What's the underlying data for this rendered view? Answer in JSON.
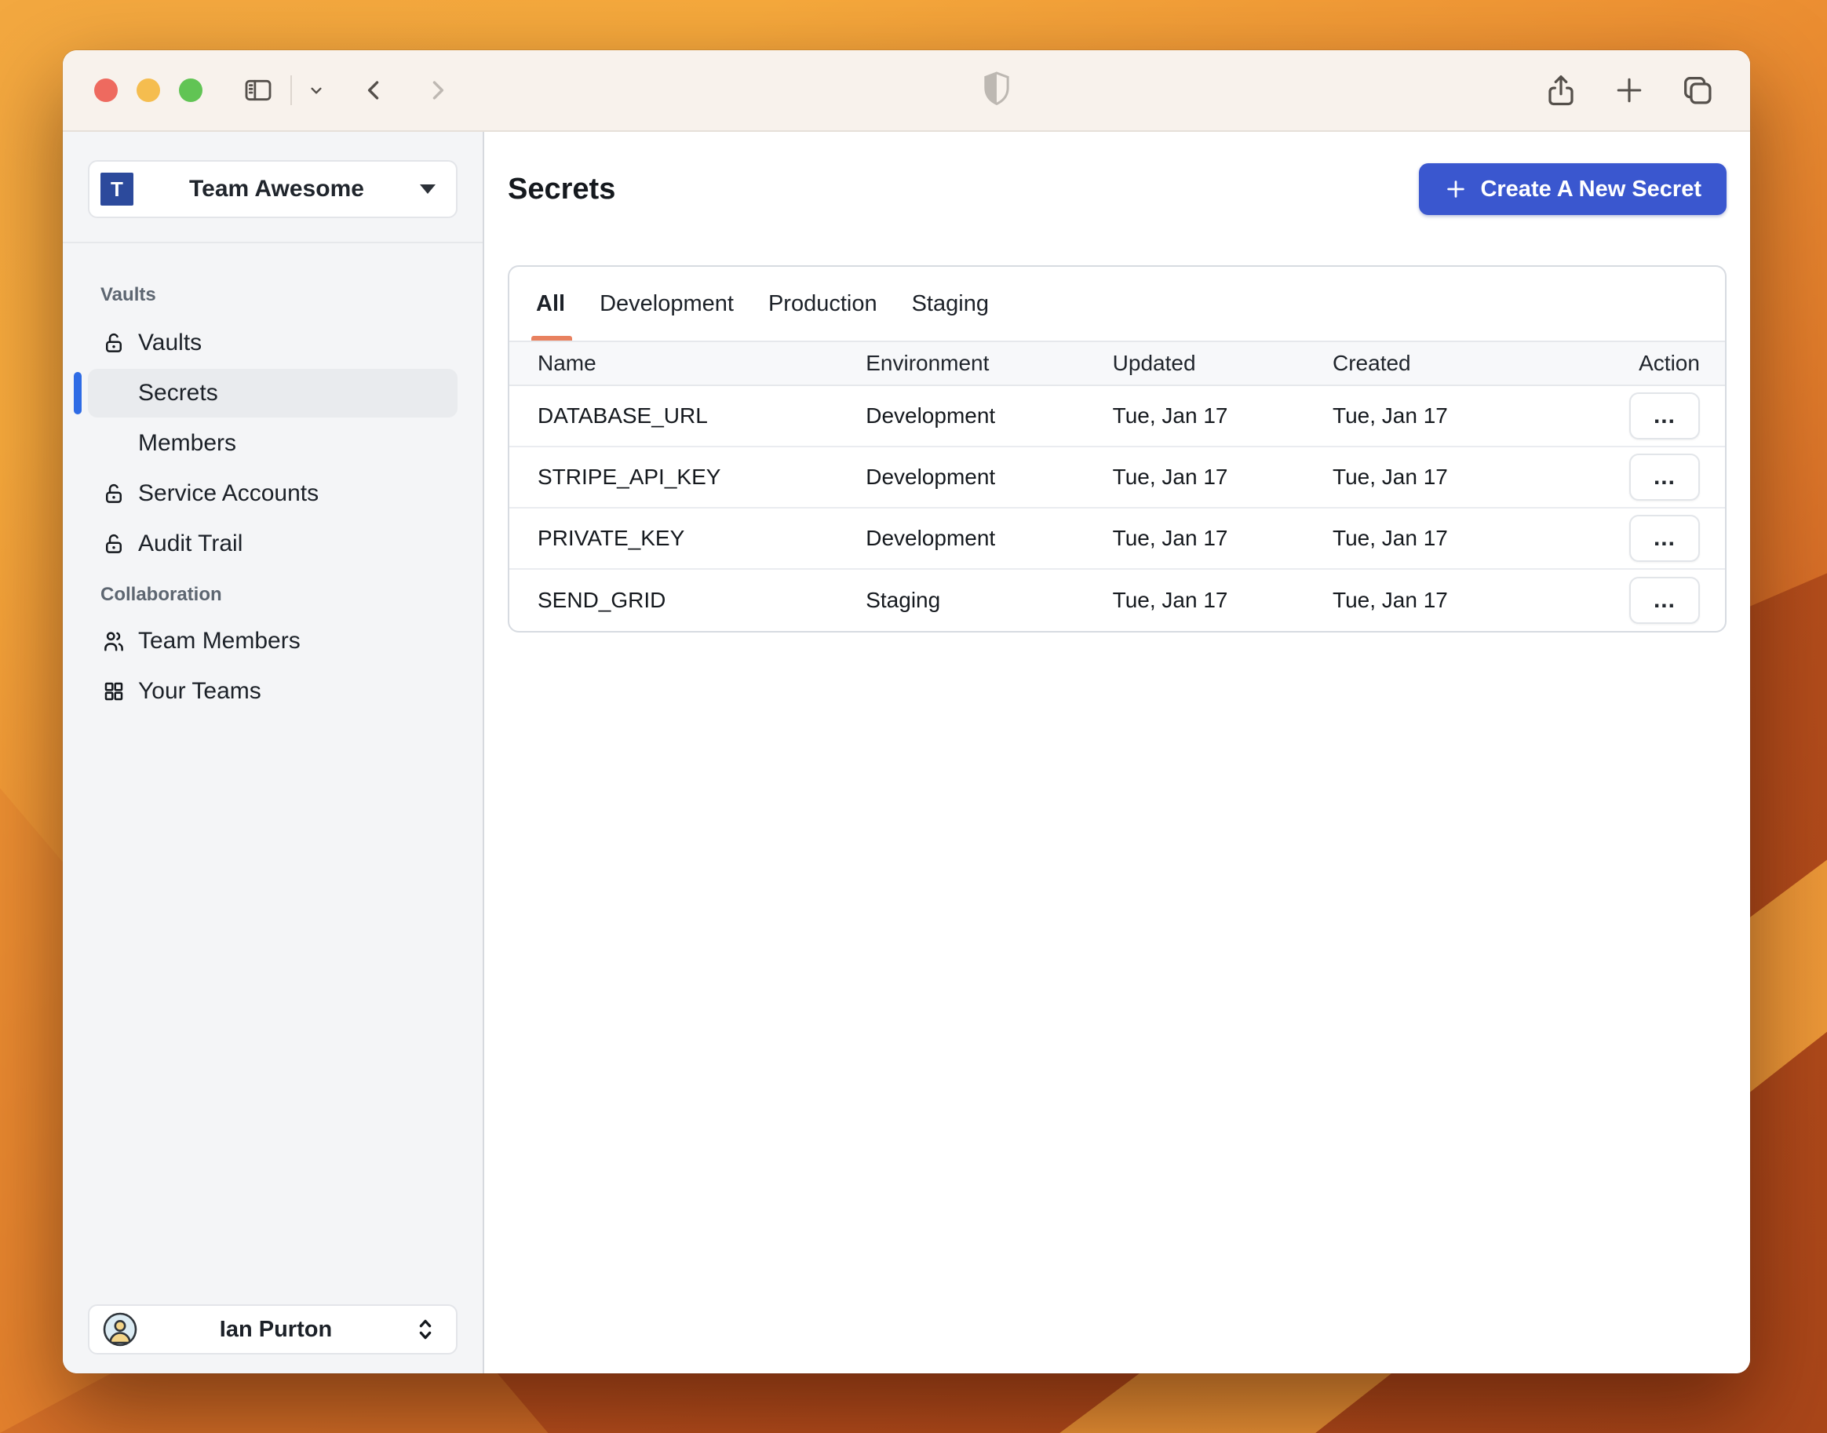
{
  "titlebar": {
    "icons": {
      "left": [
        "sidebar-toggle",
        "chevron-down",
        "nav-back",
        "nav-forward"
      ],
      "center": "shield",
      "right": [
        "share",
        "new-tab-plus",
        "tab-overview"
      ]
    }
  },
  "sidebar": {
    "team": {
      "initial": "T",
      "name": "Team Awesome"
    },
    "sections": [
      {
        "label": "Vaults",
        "items": [
          {
            "label": "Vaults",
            "icon": "lock-open"
          },
          {
            "label": "Secrets",
            "icon": null,
            "active": true
          },
          {
            "label": "Members",
            "icon": null
          },
          {
            "label": "Service Accounts",
            "icon": "lock-open"
          },
          {
            "label": "Audit Trail",
            "icon": "lock-open"
          }
        ]
      },
      {
        "label": "Collaboration",
        "items": [
          {
            "label": "Team Members",
            "icon": "people"
          },
          {
            "label": "Your Teams",
            "icon": "grid"
          }
        ]
      }
    ],
    "user": {
      "name": "Ian Purton"
    }
  },
  "main": {
    "title": "Secrets",
    "create_button": {
      "label": "Create A New Secret",
      "icon": "plus"
    },
    "tabs": [
      {
        "label": "All",
        "active": true
      },
      {
        "label": "Development"
      },
      {
        "label": "Production"
      },
      {
        "label": "Staging"
      }
    ],
    "table": {
      "columns": [
        "Name",
        "Environment",
        "Updated",
        "Created",
        "Action"
      ],
      "rows": [
        {
          "name": "DATABASE_URL",
          "environment": "Development",
          "updated": "Tue, Jan 17",
          "created": "Tue, Jan 17"
        },
        {
          "name": "STRIPE_API_KEY",
          "environment": "Development",
          "updated": "Tue, Jan 17",
          "created": "Tue, Jan 17"
        },
        {
          "name": "PRIVATE_KEY",
          "environment": "Development",
          "updated": "Tue, Jan 17",
          "created": "Tue, Jan 17"
        },
        {
          "name": "SEND_GRID",
          "environment": "Staging",
          "updated": "Tue, Jan 17",
          "created": "Tue, Jan 17"
        }
      ],
      "row_action_label": "..."
    }
  },
  "colors": {
    "accent_blue": "#3a57cf",
    "active_indicator_blue": "#2e6be5",
    "team_avatar_blue": "#2c4a9c",
    "tab_underline_salmon": "#e8815f",
    "traffic_red": "#ee6a5f",
    "traffic_yellow": "#f5bd4f",
    "traffic_green": "#61c454",
    "titlebar_bg": "#f8f2ec",
    "sidebar_bg": "#f4f5f7"
  }
}
